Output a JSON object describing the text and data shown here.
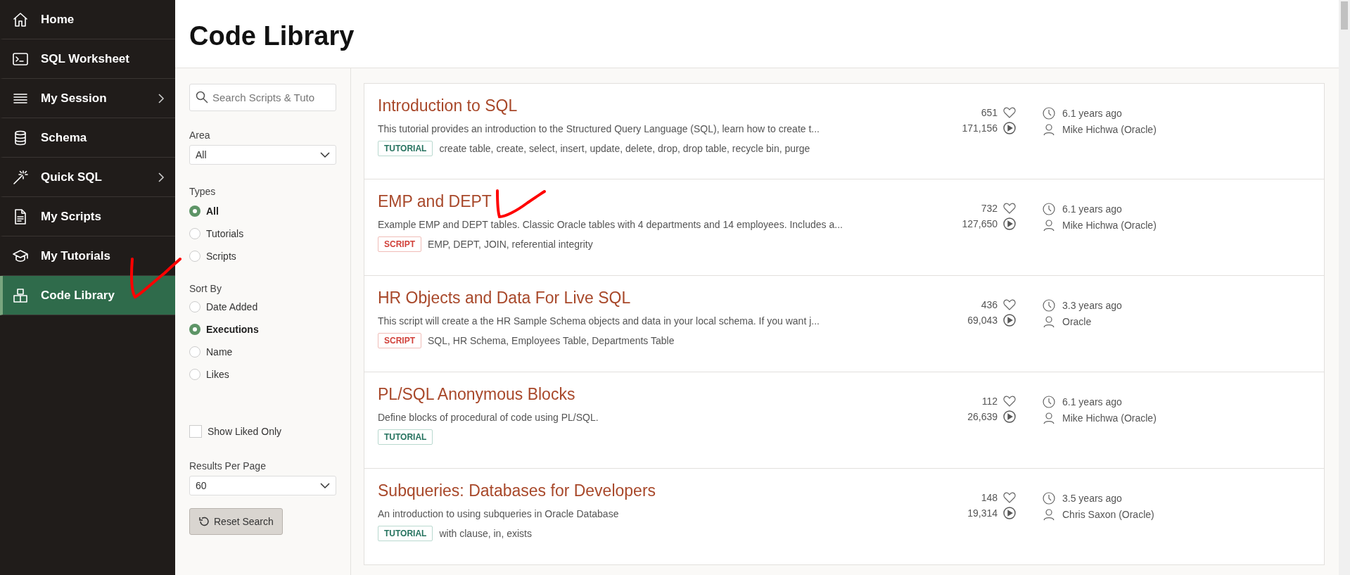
{
  "sidebar": {
    "items": [
      {
        "label": "Home",
        "has_submenu": false,
        "selected": false
      },
      {
        "label": "SQL Worksheet",
        "has_submenu": false,
        "selected": false
      },
      {
        "label": "My Session",
        "has_submenu": true,
        "selected": false
      },
      {
        "label": "Schema",
        "has_submenu": false,
        "selected": false
      },
      {
        "label": "Quick SQL",
        "has_submenu": true,
        "selected": false
      },
      {
        "label": "My Scripts",
        "has_submenu": false,
        "selected": false
      },
      {
        "label": "My Tutorials",
        "has_submenu": false,
        "selected": false
      },
      {
        "label": "Code Library",
        "has_submenu": false,
        "selected": true
      }
    ]
  },
  "page_title": "Code Library",
  "filters": {
    "search": {
      "placeholder": "Search Scripts & Tuto"
    },
    "area": {
      "label": "Area",
      "value": "All"
    },
    "types": {
      "label": "Types",
      "options": [
        {
          "label": "All",
          "selected": true
        },
        {
          "label": "Tutorials",
          "selected": false
        },
        {
          "label": "Scripts",
          "selected": false
        }
      ]
    },
    "sort_by": {
      "label": "Sort By",
      "options": [
        {
          "label": "Date Added",
          "selected": false
        },
        {
          "label": "Executions",
          "selected": true
        },
        {
          "label": "Name",
          "selected": false
        },
        {
          "label": "Likes",
          "selected": false
        }
      ]
    },
    "show_liked_only": {
      "label": "Show Liked Only",
      "checked": false
    },
    "results_per_page": {
      "label": "Results Per Page",
      "value": "60"
    },
    "reset_button": "Reset Search"
  },
  "cards": [
    {
      "title": "Introduction to SQL",
      "description": "This tutorial provides an introduction to the Structured Query Language (SQL), learn how to create t...",
      "kind": "tutorial",
      "badge": "TUTORIAL",
      "tags": "create table, create, select, insert, update, delete, drop, drop table, recycle bin, purge",
      "likes": "651",
      "executions": "171,156",
      "age": "6.1 years ago",
      "author": "Mike Hichwa (Oracle)"
    },
    {
      "title": "EMP and DEPT",
      "description": "Example EMP and DEPT tables. Classic Oracle tables with 4 departments and 14 employees. Includes a...",
      "kind": "script",
      "badge": "SCRIPT",
      "tags": "EMP, DEPT, JOIN, referential integrity",
      "likes": "732",
      "executions": "127,650",
      "age": "6.1 years ago",
      "author": "Mike Hichwa (Oracle)"
    },
    {
      "title": "HR Objects and Data For Live SQL",
      "description": "This script will create a the HR Sample Schema objects and data in your local schema. If you want j...",
      "kind": "script",
      "badge": "SCRIPT",
      "tags": "SQL, HR Schema, Employees Table, Departments Table",
      "likes": "436",
      "executions": "69,043",
      "age": "3.3 years ago",
      "author": "Oracle"
    },
    {
      "title": "PL/SQL Anonymous Blocks",
      "description": "Define blocks of procedural of code using PL/SQL.",
      "kind": "tutorial",
      "badge": "TUTORIAL",
      "likes": "112",
      "executions": "26,639",
      "age": "6.1 years ago",
      "author": "Mike Hichwa (Oracle)"
    },
    {
      "title": "Subqueries: Databases for Developers",
      "description": "An introduction to using subqueries in Oracle Database",
      "kind": "tutorial",
      "badge": "TUTORIAL",
      "tags": "with clause, in, exists",
      "likes": "148",
      "executions": "19,314",
      "age": "3.5 years ago",
      "author": "Chris Saxon (Oracle)"
    }
  ]
}
